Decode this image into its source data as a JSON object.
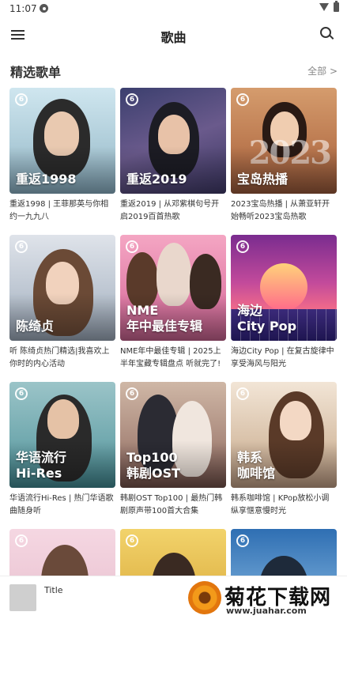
{
  "status_bar": {
    "time": "11:07"
  },
  "header": {
    "title": "歌曲"
  },
  "section": {
    "title": "精选歌单",
    "more": "全部 >"
  },
  "playlists": [
    {
      "cover_title": "重返1998",
      "caption": "重返1998 | 王菲那英与你相约一九九八"
    },
    {
      "cover_title": "重返2019",
      "caption": "重返2019 | 从邓紫棋句号开启2019百首热歌"
    },
    {
      "cover_title": "宝岛热播",
      "caption": "2023宝岛热播 | 从萧亚轩开始畅听2023宝岛热歌",
      "deco": "2023"
    },
    {
      "cover_title": "陈绮贞",
      "caption": "听 陈绮贞热门精选|我喜欢上你时的内心活动"
    },
    {
      "cover_title": "NME\n年中最佳专辑",
      "caption": "NME年中最佳专辑 | 2025上半年宝藏专辑盘点  听就完了!"
    },
    {
      "cover_title": "海边\nCity Pop",
      "caption": "海边City Pop | 在复古旋律中享受海风与阳光"
    },
    {
      "cover_title": "华语流行\nHi-Res",
      "caption": "华语流行Hi-Res | 热门华语歌曲随身听"
    },
    {
      "cover_title": "Top100\n韩剧OST",
      "caption": "韩剧OST Top100 | 最热门韩剧原声带100首大合集"
    },
    {
      "cover_title": "韩系\n咖啡馆",
      "caption": "韩系咖啡馆 | KPop放松小调 纵享惬意慢时光"
    }
  ],
  "partial_row": [
    {
      "cover_title": ""
    },
    {
      "cover_title": ""
    },
    {
      "cover_title": ""
    }
  ],
  "player": {
    "title": "Title"
  },
  "watermark": {
    "main": "菊花下载网",
    "url": "www.juahar.com"
  }
}
